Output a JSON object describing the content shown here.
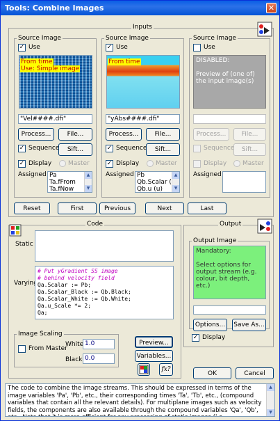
{
  "window": {
    "title": "Tools: Combine Images",
    "close_glyph": "✕"
  },
  "inputs": {
    "group_label": "Inputs",
    "sources": [
      {
        "group_label": "Source Image",
        "use_label": "Use",
        "use_checked": true,
        "preview_lines": [
          "From time",
          "Use: Simple image"
        ],
        "filename": "\"Vel####.dfi\"",
        "process_label": "Process...",
        "file_label": "File...",
        "sequence_label": "Sequence",
        "sequence_checked": true,
        "sift_label": "Sift...",
        "display_label": "Display",
        "display_checked": true,
        "master_label": "Master",
        "assigned_label": "Assigned to",
        "assigned_items": [
          "Pa",
          "Ta.fFrom",
          "Ta.fNow"
        ]
      },
      {
        "group_label": "Source Image",
        "use_label": "Use",
        "use_checked": true,
        "preview_lines": [
          "From time"
        ],
        "filename": "\"yAbs####.dfi\"",
        "process_label": "Process...",
        "file_label": "File...",
        "sequence_label": "Sequence",
        "sequence_checked": true,
        "sift_label": "Sift...",
        "display_label": "Display",
        "display_checked": true,
        "master_label": "Master",
        "assigned_label": "Assigned to",
        "assigned_items": [
          "Pb",
          "Qb.Scalar (Ve",
          "Qb.u (u)"
        ]
      },
      {
        "group_label": "Source Image",
        "use_label": "Use",
        "use_checked": false,
        "preview_text": "DISABLED:\n\nPreview of (one of) the input image(s)",
        "filename": "",
        "process_label": "Process...",
        "file_label": "File...",
        "sequence_label": "Sequence",
        "sequence_checked": false,
        "sift_label": "Sift...",
        "display_label": "Display",
        "display_checked": false,
        "master_label": "Master",
        "assigned_label": "Assigned to",
        "assigned_items": []
      }
    ],
    "nav": {
      "reset": "Reset",
      "first": "First",
      "previous": "Previous",
      "next": "Next",
      "last": "Last"
    }
  },
  "code": {
    "group_label": "Code",
    "static_label": "Static",
    "static_value": "",
    "varying_label": "Varying",
    "varying_lines": [
      {
        "text": "# Put yGradient SS image",
        "kind": "comment"
      },
      {
        "text": "# behind velocity field",
        "kind": "comment"
      },
      {
        "text": "Qa.Scalar := Pb;",
        "kind": "code"
      },
      {
        "text": "Qa.Scalar_Black := Qb.Black;",
        "kind": "code"
      },
      {
        "text": "Qa.Scalar_White := Qb.White;",
        "kind": "code"
      },
      {
        "text": "Qa.u_Scale *= 2;",
        "kind": "code"
      },
      {
        "text": "Qa;",
        "kind": "code"
      }
    ],
    "scaling": {
      "group_label": "Image Scaling",
      "from_master_label": "From Master",
      "from_master_checked": false,
      "white_label": "White",
      "white_value": "1.0",
      "black_label": "Black",
      "black_value": "0.0"
    },
    "preview_label": "Preview...",
    "variables_label": "Variables...",
    "fx_label": "fx?"
  },
  "output": {
    "group_label": "Output",
    "image_label": "Output Image",
    "preview_text": "Mandatory:\n\nSelect options for output stream (e.g. colour, bit depth, etc.)",
    "filename": "",
    "options_label": "Options...",
    "save_as_label": "Save As...",
    "display_label": "Display",
    "display_checked": true
  },
  "footer": {
    "ok_label": "OK",
    "cancel_label": "Cancel",
    "help_text": "The code to combine the image streams. This should be expressed in terms of the image variables 'Pa', 'Pb', etc., their corresponding times 'Ta', 'Tb', etc., (compound variables that contain all the relevant details). For multiplane images such as velocity fields, the components are also available through the compound variables 'Qa', 'Qb', etc.. Note that it is more efficient for any processing of static images (i.e."
  },
  "colors": {
    "title_bar": "#0a5fe6",
    "dialog_bg": "#ece9d8",
    "highlight_yellow": "#ffff00",
    "output_green": "#7cf07c",
    "disabled_gray": "#a8a8a8",
    "code_comment": "#c000c0"
  }
}
